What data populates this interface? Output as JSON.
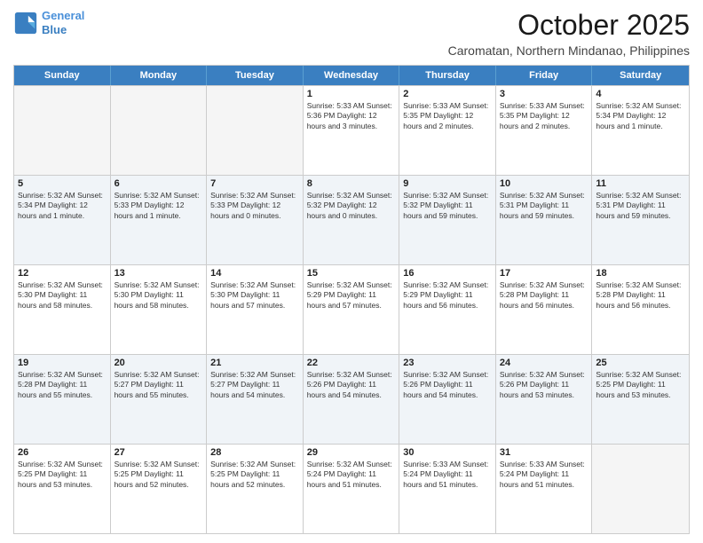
{
  "logo": {
    "line1": "General",
    "line2": "Blue"
  },
  "title": "October 2025",
  "location": "Caromatan, Northern Mindanao, Philippines",
  "header_days": [
    "Sunday",
    "Monday",
    "Tuesday",
    "Wednesday",
    "Thursday",
    "Friday",
    "Saturday"
  ],
  "rows": [
    [
      {
        "day": "",
        "text": "",
        "empty": true
      },
      {
        "day": "",
        "text": "",
        "empty": true
      },
      {
        "day": "",
        "text": "",
        "empty": true
      },
      {
        "day": "1",
        "text": "Sunrise: 5:33 AM\nSunset: 5:36 PM\nDaylight: 12 hours and 3 minutes."
      },
      {
        "day": "2",
        "text": "Sunrise: 5:33 AM\nSunset: 5:35 PM\nDaylight: 12 hours and 2 minutes."
      },
      {
        "day": "3",
        "text": "Sunrise: 5:33 AM\nSunset: 5:35 PM\nDaylight: 12 hours and 2 minutes."
      },
      {
        "day": "4",
        "text": "Sunrise: 5:32 AM\nSunset: 5:34 PM\nDaylight: 12 hours and 1 minute."
      }
    ],
    [
      {
        "day": "5",
        "text": "Sunrise: 5:32 AM\nSunset: 5:34 PM\nDaylight: 12 hours and 1 minute."
      },
      {
        "day": "6",
        "text": "Sunrise: 5:32 AM\nSunset: 5:33 PM\nDaylight: 12 hours and 1 minute."
      },
      {
        "day": "7",
        "text": "Sunrise: 5:32 AM\nSunset: 5:33 PM\nDaylight: 12 hours and 0 minutes."
      },
      {
        "day": "8",
        "text": "Sunrise: 5:32 AM\nSunset: 5:32 PM\nDaylight: 12 hours and 0 minutes."
      },
      {
        "day": "9",
        "text": "Sunrise: 5:32 AM\nSunset: 5:32 PM\nDaylight: 11 hours and 59 minutes."
      },
      {
        "day": "10",
        "text": "Sunrise: 5:32 AM\nSunset: 5:31 PM\nDaylight: 11 hours and 59 minutes."
      },
      {
        "day": "11",
        "text": "Sunrise: 5:32 AM\nSunset: 5:31 PM\nDaylight: 11 hours and 59 minutes."
      }
    ],
    [
      {
        "day": "12",
        "text": "Sunrise: 5:32 AM\nSunset: 5:30 PM\nDaylight: 11 hours and 58 minutes."
      },
      {
        "day": "13",
        "text": "Sunrise: 5:32 AM\nSunset: 5:30 PM\nDaylight: 11 hours and 58 minutes."
      },
      {
        "day": "14",
        "text": "Sunrise: 5:32 AM\nSunset: 5:30 PM\nDaylight: 11 hours and 57 minutes."
      },
      {
        "day": "15",
        "text": "Sunrise: 5:32 AM\nSunset: 5:29 PM\nDaylight: 11 hours and 57 minutes."
      },
      {
        "day": "16",
        "text": "Sunrise: 5:32 AM\nSunset: 5:29 PM\nDaylight: 11 hours and 56 minutes."
      },
      {
        "day": "17",
        "text": "Sunrise: 5:32 AM\nSunset: 5:28 PM\nDaylight: 11 hours and 56 minutes."
      },
      {
        "day": "18",
        "text": "Sunrise: 5:32 AM\nSunset: 5:28 PM\nDaylight: 11 hours and 56 minutes."
      }
    ],
    [
      {
        "day": "19",
        "text": "Sunrise: 5:32 AM\nSunset: 5:28 PM\nDaylight: 11 hours and 55 minutes."
      },
      {
        "day": "20",
        "text": "Sunrise: 5:32 AM\nSunset: 5:27 PM\nDaylight: 11 hours and 55 minutes."
      },
      {
        "day": "21",
        "text": "Sunrise: 5:32 AM\nSunset: 5:27 PM\nDaylight: 11 hours and 54 minutes."
      },
      {
        "day": "22",
        "text": "Sunrise: 5:32 AM\nSunset: 5:26 PM\nDaylight: 11 hours and 54 minutes."
      },
      {
        "day": "23",
        "text": "Sunrise: 5:32 AM\nSunset: 5:26 PM\nDaylight: 11 hours and 54 minutes."
      },
      {
        "day": "24",
        "text": "Sunrise: 5:32 AM\nSunset: 5:26 PM\nDaylight: 11 hours and 53 minutes."
      },
      {
        "day": "25",
        "text": "Sunrise: 5:32 AM\nSunset: 5:25 PM\nDaylight: 11 hours and 53 minutes."
      }
    ],
    [
      {
        "day": "26",
        "text": "Sunrise: 5:32 AM\nSunset: 5:25 PM\nDaylight: 11 hours and 53 minutes."
      },
      {
        "day": "27",
        "text": "Sunrise: 5:32 AM\nSunset: 5:25 PM\nDaylight: 11 hours and 52 minutes."
      },
      {
        "day": "28",
        "text": "Sunrise: 5:32 AM\nSunset: 5:25 PM\nDaylight: 11 hours and 52 minutes."
      },
      {
        "day": "29",
        "text": "Sunrise: 5:32 AM\nSunset: 5:24 PM\nDaylight: 11 hours and 51 minutes."
      },
      {
        "day": "30",
        "text": "Sunrise: 5:33 AM\nSunset: 5:24 PM\nDaylight: 11 hours and 51 minutes."
      },
      {
        "day": "31",
        "text": "Sunrise: 5:33 AM\nSunset: 5:24 PM\nDaylight: 11 hours and 51 minutes."
      },
      {
        "day": "",
        "text": "",
        "empty": true
      }
    ]
  ]
}
